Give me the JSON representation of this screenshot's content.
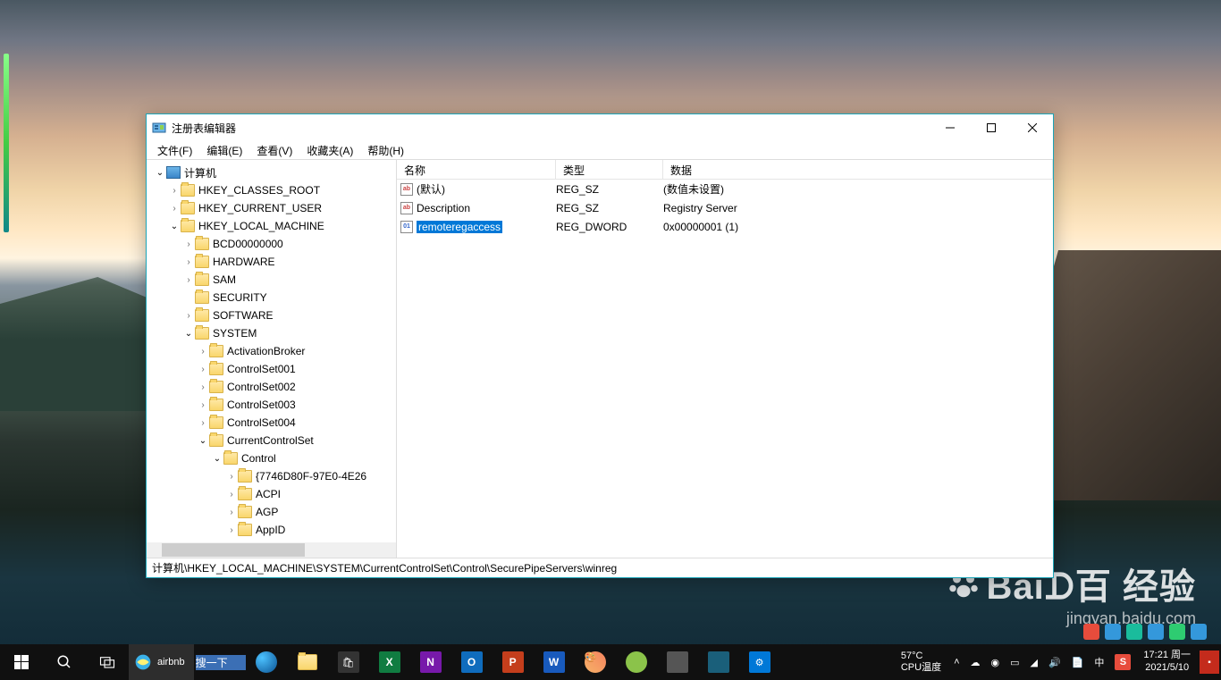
{
  "window": {
    "title": "注册表编辑器",
    "menus": [
      "文件(F)",
      "编辑(E)",
      "查看(V)",
      "收藏夹(A)",
      "帮助(H)"
    ],
    "statusbar": "计算机\\HKEY_LOCAL_MACHINE\\SYSTEM\\CurrentControlSet\\Control\\SecurePipeServers\\winreg"
  },
  "tree": [
    {
      "d": 0,
      "exp": "open",
      "icon": "computer",
      "label": "计算机"
    },
    {
      "d": 1,
      "exp": "closed",
      "icon": "folder",
      "label": "HKEY_CLASSES_ROOT"
    },
    {
      "d": 1,
      "exp": "closed",
      "icon": "folder",
      "label": "HKEY_CURRENT_USER"
    },
    {
      "d": 1,
      "exp": "open",
      "icon": "folder",
      "label": "HKEY_LOCAL_MACHINE"
    },
    {
      "d": 2,
      "exp": "closed",
      "icon": "folder",
      "label": "BCD00000000"
    },
    {
      "d": 2,
      "exp": "closed",
      "icon": "folder",
      "label": "HARDWARE"
    },
    {
      "d": 2,
      "exp": "closed",
      "icon": "folder",
      "label": "SAM"
    },
    {
      "d": 2,
      "exp": "",
      "icon": "folder",
      "label": "SECURITY"
    },
    {
      "d": 2,
      "exp": "closed",
      "icon": "folder",
      "label": "SOFTWARE"
    },
    {
      "d": 2,
      "exp": "open",
      "icon": "folder",
      "label": "SYSTEM"
    },
    {
      "d": 3,
      "exp": "closed",
      "icon": "folder",
      "label": "ActivationBroker"
    },
    {
      "d": 3,
      "exp": "closed",
      "icon": "folder",
      "label": "ControlSet001"
    },
    {
      "d": 3,
      "exp": "closed",
      "icon": "folder",
      "label": "ControlSet002"
    },
    {
      "d": 3,
      "exp": "closed",
      "icon": "folder",
      "label": "ControlSet003"
    },
    {
      "d": 3,
      "exp": "closed",
      "icon": "folder",
      "label": "ControlSet004"
    },
    {
      "d": 3,
      "exp": "open",
      "icon": "folder",
      "label": "CurrentControlSet"
    },
    {
      "d": 4,
      "exp": "open",
      "icon": "folder",
      "label": "Control"
    },
    {
      "d": 5,
      "exp": "closed",
      "icon": "folder",
      "label": "{7746D80F-97E0-4E26"
    },
    {
      "d": 5,
      "exp": "closed",
      "icon": "folder",
      "label": "ACPI"
    },
    {
      "d": 5,
      "exp": "closed",
      "icon": "folder",
      "label": "AGP"
    },
    {
      "d": 5,
      "exp": "closed",
      "icon": "folder",
      "label": "AppID"
    }
  ],
  "list": {
    "headers": {
      "name": "名称",
      "type": "类型",
      "data": "数据"
    },
    "rows": [
      {
        "icon": "sz",
        "name": "(默认)",
        "type": "REG_SZ",
        "data": "(数值未设置)",
        "selected": false
      },
      {
        "icon": "sz",
        "name": "Description",
        "type": "REG_SZ",
        "data": "Registry Server",
        "selected": false
      },
      {
        "icon": "dw",
        "name": "remoteregaccess",
        "type": "REG_DWORD",
        "data": "0x00000001 (1)",
        "selected": true
      }
    ]
  },
  "taskbar": {
    "ie_task": "airbnb",
    "search_btn": "搜一下",
    "temp1": "57°C",
    "temp2": "CPU温度",
    "ime": "中",
    "time": "17:21 周一",
    "date": "2021/5/10"
  },
  "watermark": {
    "brand": "Baiᗪ百 经验",
    "sub": "jingyan.baidu.com"
  }
}
